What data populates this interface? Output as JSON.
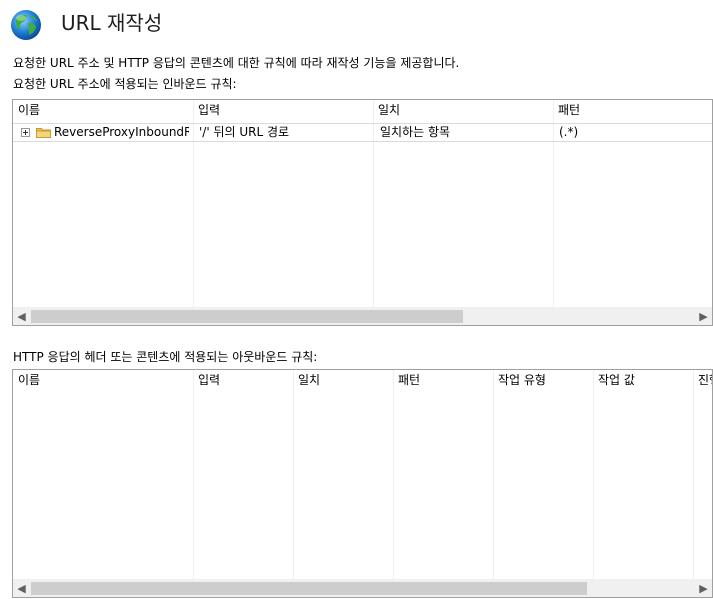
{
  "header": {
    "icon": "globe-icon",
    "title": "URL 재작성"
  },
  "description": "요청한 URL 주소 및 HTTP 응답의 콘텐츠에 대한 규칙에 따라 재작성 기능을 제공합니다.",
  "inbound": {
    "label": "요청한 URL 주소에 적용되는 인바운드 규칙:",
    "columns": [
      "이름",
      "입력",
      "일치",
      "패턴"
    ],
    "rows": [
      {
        "name": "ReverseProxyInboundR...",
        "input": "'/' 뒤의 URL 경로",
        "match": "일치하는 항목",
        "pattern": "(.*)"
      }
    ],
    "scroll_left": "◀",
    "scroll_right": "▶"
  },
  "outbound": {
    "label": "HTTP 응답의 헤더 또는 콘텐츠에 적용되는 아웃바운드 규칙:",
    "columns": [
      "이름",
      "입력",
      "일치",
      "패턴",
      "작업 유형",
      "작업 값",
      "진행"
    ],
    "scroll_left": "◀",
    "scroll_right": "▶"
  },
  "colors": {
    "panel_border": "#a0a0a0",
    "scroll_track": "#f0f0f0",
    "scroll_thumb": "#cdcdcd",
    "folder": "#e8c15a"
  }
}
